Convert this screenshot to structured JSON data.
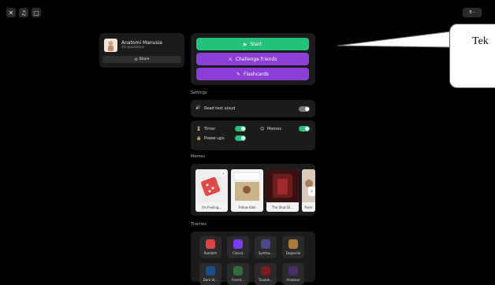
{
  "top": {
    "close_icon": "close-icon",
    "music_icon": "music-icon",
    "box_icon": "square-icon",
    "right_badge_text": "8 –"
  },
  "quiz": {
    "title": "Anatomi Manusia",
    "subtitle": "10 questions",
    "share_label": "Share"
  },
  "actions": {
    "start_label": "Start",
    "challenge_label": "Challenge friends",
    "flashcards_label": "Flashcards"
  },
  "settings": {
    "heading": "Settings",
    "read_text_label": "Read text aloud",
    "timer_label": "Timer",
    "memes_label": "Memes",
    "powerups_label": "Power-ups"
  },
  "memes_section": {
    "heading": "Memes",
    "items": [
      {
        "caption": "I'm Feeling..."
      },
      {
        "caption": "Fellow Kids"
      },
      {
        "caption": "The Shut Di..."
      },
      {
        "caption": "Parer"
      }
    ]
  },
  "themes_section": {
    "heading": "Themes",
    "items": [
      {
        "label": "Random",
        "color": "#d44"
      },
      {
        "label": "Classic",
        "color": "#7a3cf0"
      },
      {
        "label": "Synthw...",
        "color": "#4b4a88"
      },
      {
        "label": "Dogsville",
        "color": "#b07a3a"
      },
      {
        "label": "Dark St...",
        "color": "#1a4e8a"
      },
      {
        "label": "Forest...",
        "color": "#2f6a3e"
      },
      {
        "label": "Trouble...",
        "color": "#7a1c1c"
      },
      {
        "label": "Amateur",
        "color": "#4a2d6a"
      }
    ]
  },
  "callout": {
    "text": "Tek"
  }
}
